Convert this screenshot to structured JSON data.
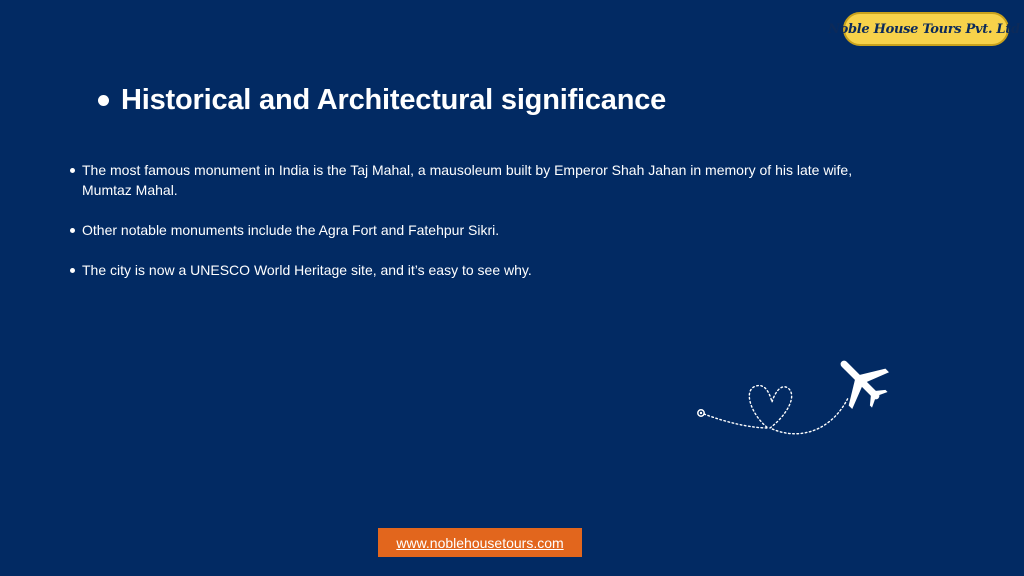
{
  "brand": {
    "logo_text": "Noble House Tours Pvt. Ltd.",
    "badge_color": "#f7d24a"
  },
  "slide": {
    "background_color": "#022a63",
    "heading": "Historical and Architectural significance",
    "bullets": [
      "The most famous monument in India is the Taj Mahal, a mausoleum built by Emperor Shah Jahan in memory of his late wife, Mumtaz Mahal.",
      "Other notable monuments include the Agra Fort and Fatehpur Sikri.",
      "The city is now a UNESCO World Heritage site, and it’s easy to see why."
    ]
  },
  "decoration": {
    "plane_icon": "airplane-icon",
    "route_icon": "dotted-heart-route-icon"
  },
  "footer": {
    "website_label": "www.noblehousetours.com",
    "button_color": "#e2661d"
  }
}
